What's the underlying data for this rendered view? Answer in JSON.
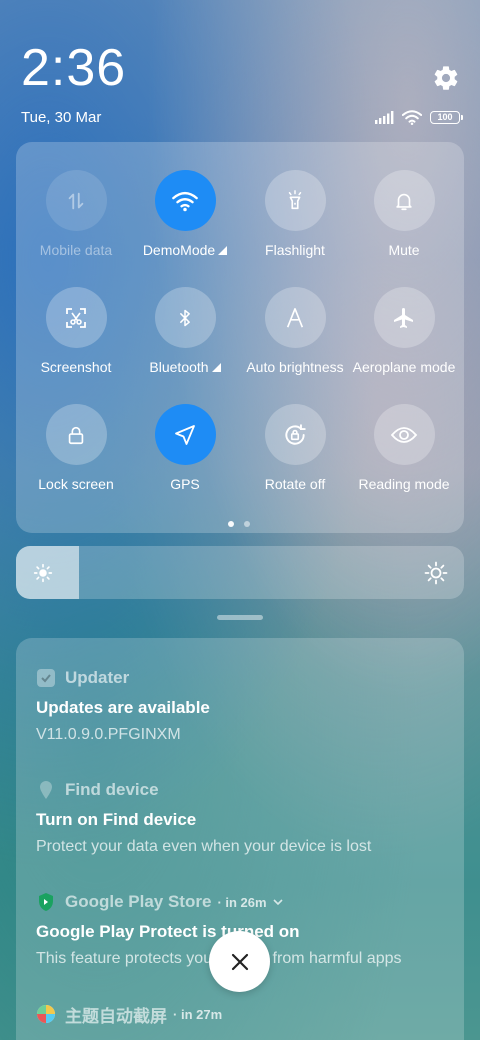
{
  "header": {
    "time": "2:36",
    "date": "Tue, 30 Mar",
    "battery_level": "100"
  },
  "quick_settings": {
    "tiles": [
      {
        "label": "Mobile data",
        "icon": "mobile-data-icon",
        "state": "disabled"
      },
      {
        "label": "DemoMode",
        "icon": "wifi-icon",
        "state": "on"
      },
      {
        "label": "Flashlight",
        "icon": "flashlight-icon",
        "state": "off"
      },
      {
        "label": "Mute",
        "icon": "bell-icon",
        "state": "off"
      },
      {
        "label": "Screenshot",
        "icon": "screenshot-icon",
        "state": "off"
      },
      {
        "label": "Bluetooth",
        "icon": "bluetooth-icon",
        "state": "off"
      },
      {
        "label": "Auto brightness",
        "icon": "auto-brightness-icon",
        "state": "off"
      },
      {
        "label": "Aeroplane mode",
        "icon": "airplane-icon",
        "state": "off"
      },
      {
        "label": "Lock screen",
        "icon": "lock-icon",
        "state": "off"
      },
      {
        "label": "GPS",
        "icon": "location-arrow-icon",
        "state": "on"
      },
      {
        "label": "Rotate off",
        "icon": "rotate-lock-icon",
        "state": "off"
      },
      {
        "label": "Reading mode",
        "icon": "eye-icon",
        "state": "off"
      }
    ],
    "page_count": 2,
    "current_page": 1
  },
  "brightness": {
    "level_fraction": 0.14
  },
  "notifications": [
    {
      "app": "Updater",
      "time": "",
      "title": "Updates are available",
      "text": "V11.0.9.0.PFGINXM"
    },
    {
      "app": "Find device",
      "time": "",
      "title": "Turn on Find device",
      "text": "Protect your data even when your device is lost"
    },
    {
      "app": "Google Play Store",
      "time": "in 26m",
      "title": "Google Play Protect is turned on",
      "text": "This feature protects your device from harmful apps"
    },
    {
      "app": "主题自动截屏",
      "time": "in 27m",
      "title": "",
      "text": ""
    }
  ],
  "colors": {
    "accent": "#1e8cf5"
  }
}
